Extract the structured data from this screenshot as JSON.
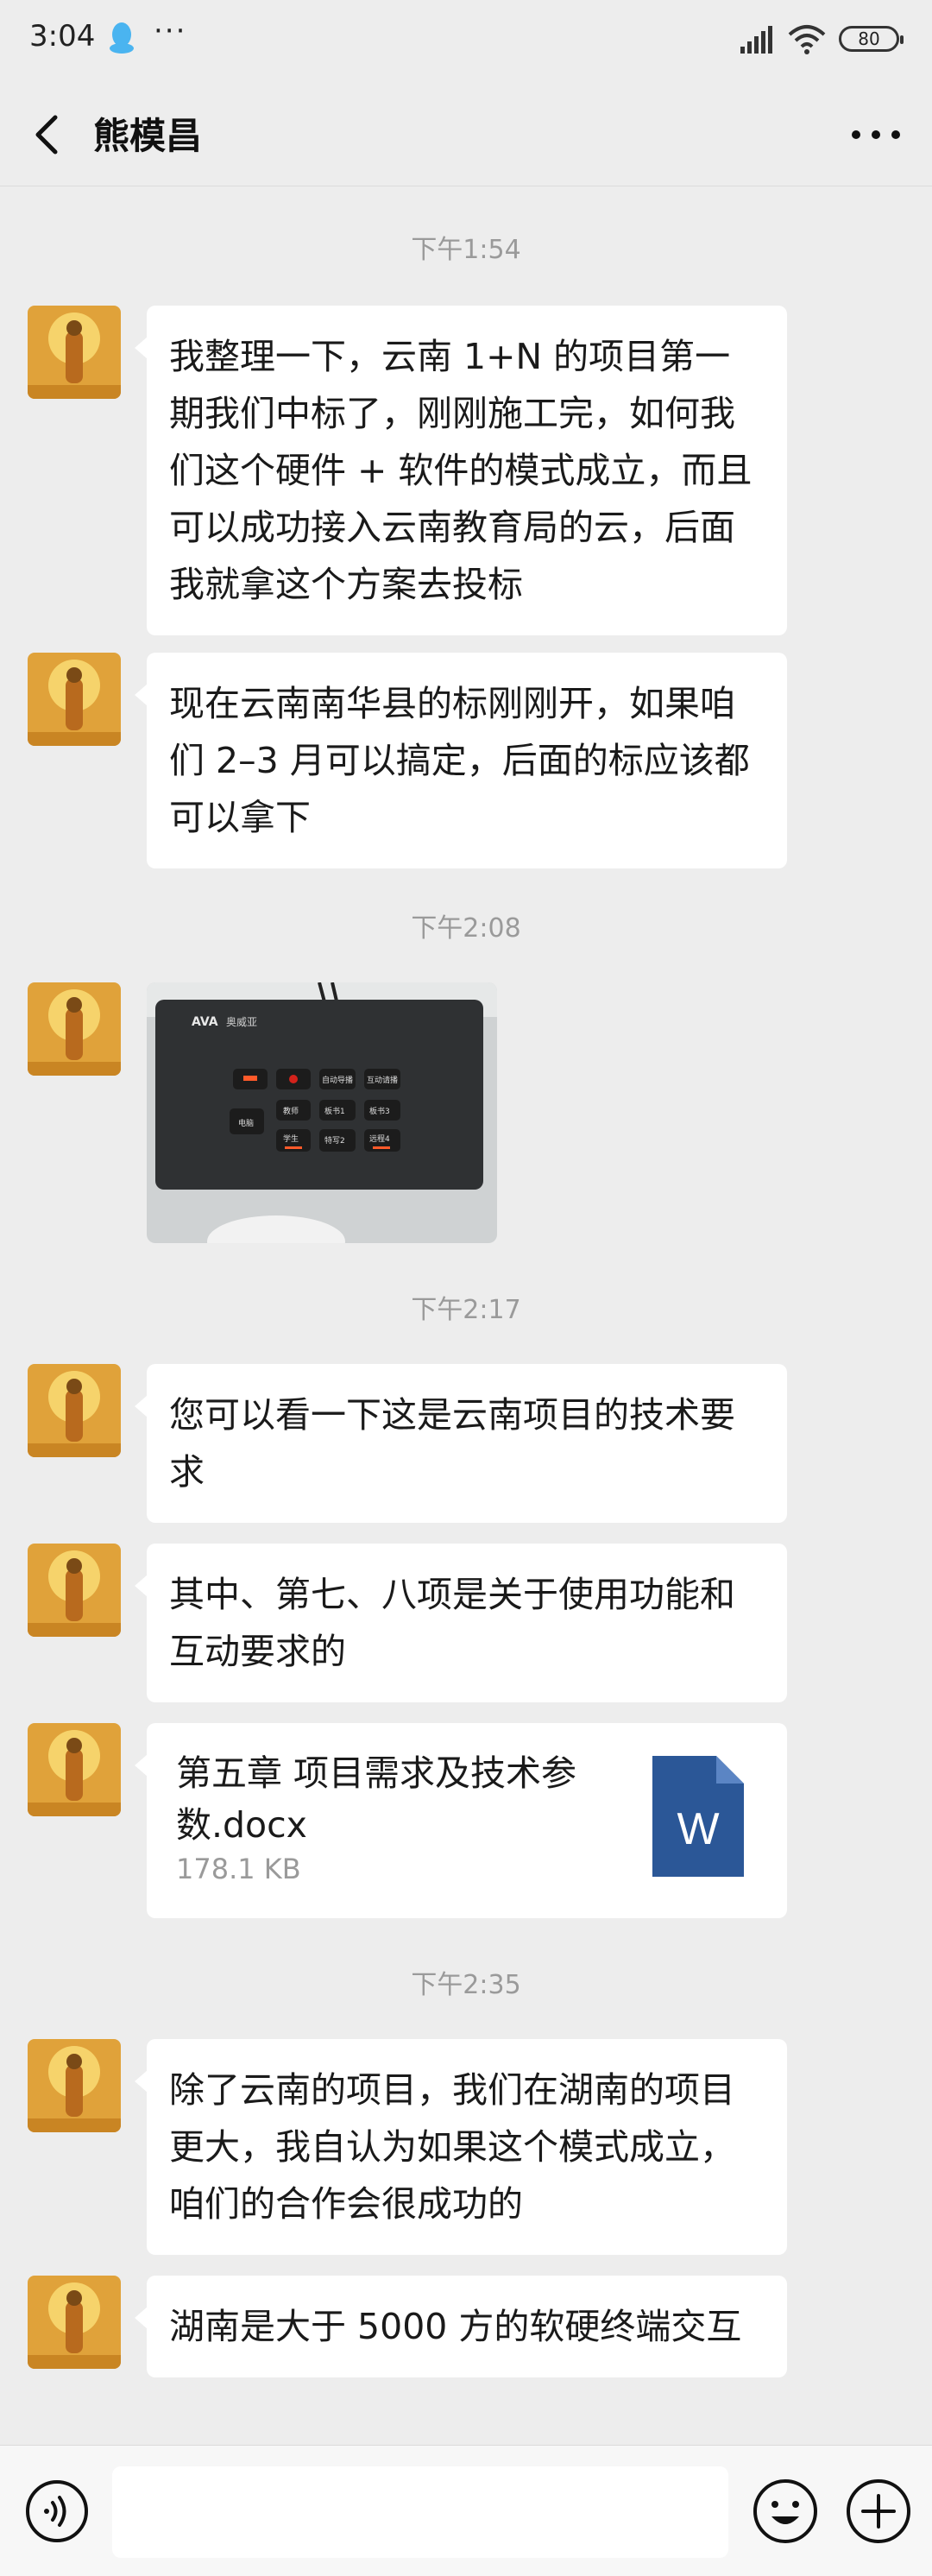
{
  "status_bar": {
    "time": "3:04",
    "dots": "···",
    "battery": "80"
  },
  "header": {
    "title": "熊模昌"
  },
  "messages": [
    {
      "type": "timestamp",
      "text": "下午1:54"
    },
    {
      "type": "text",
      "text": "我整理一下，云南 1+N 的项目第一期我们中标了，刚刚施工完，如何我们这个硬件 + 软件的模式成立，而且可以成功接入云南教育局的云，后面我就拿这个方案去投标"
    },
    {
      "type": "text",
      "text": "现在云南南华县的标刚刚开，如果咱们 2–3 月可以搞定，后面的标应该都可以拿下"
    },
    {
      "type": "timestamp",
      "text": "下午2:08"
    },
    {
      "type": "image",
      "device": {
        "brand": "奥威亚",
        "keys": [
          "自动导播",
          "互动请播",
          "教师",
          "板书1",
          "板书3",
          "电脑",
          "学生",
          "特写2",
          "远程4"
        ]
      }
    },
    {
      "type": "timestamp",
      "text": "下午2:17"
    },
    {
      "type": "text",
      "text": "您可以看一下这是云南项目的技术要求"
    },
    {
      "type": "text",
      "text": "其中、第七、八项是关于使用功能和互动要求的"
    },
    {
      "type": "file",
      "name": "第五章  项目需求及技术参数.docx",
      "size": "178.1 KB",
      "icon_letter": "W"
    },
    {
      "type": "timestamp",
      "text": "下午2:35"
    },
    {
      "type": "text",
      "text": "除了云南的项目，我们在湖南的项目更大，我自认为如果这个模式成立，咱们的合作会很成功的"
    },
    {
      "type": "text",
      "text": "湖南是大于 5000 方的软硬终端交互"
    }
  ],
  "input_bar": {
    "placeholder": ""
  },
  "colors": {
    "background": "#ededed",
    "bubble": "#ffffff",
    "timestamp": "#9a9a9a",
    "word_icon": "#2b5797"
  }
}
